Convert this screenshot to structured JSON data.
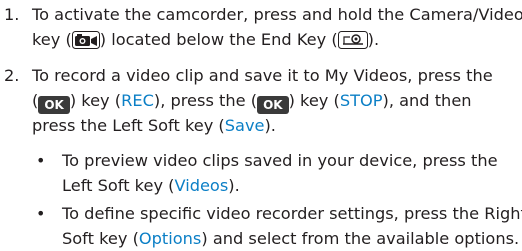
{
  "steps": [
    {
      "number": "1.",
      "line1": {
        "before": "To activate the camcorder, press and hold the Camera/Video"
      },
      "line2": {
        "before": "key (",
        "middle": ") located below the End Key (",
        "after": ")."
      },
      "icons": [
        "camera-video-key-icon",
        "end-key-icon"
      ]
    },
    {
      "number": "2.",
      "line1": {
        "before": "To record a video clip and save it to My Videos, press the"
      },
      "line2": {
        "open": "(",
        "key1": "OK",
        "mid1": ") key (",
        "rec": "REC",
        "mid2": "), press the (",
        "key2": "OK",
        "mid3": ") key (",
        "stop": "STOP",
        "after": "), and then"
      },
      "line3": {
        "before": "press the Left Soft key (",
        "save": "Save",
        "after": ")."
      }
    }
  ],
  "bullets": [
    {
      "line1": "To preview video clips saved in your device, press the",
      "line2_before": "Left Soft key (",
      "line2_hl": "Videos",
      "line2_after": ")."
    },
    {
      "line1": "To define specific video recorder settings, press the Right",
      "line2_before": "Soft key (",
      "line2_hl": "Options",
      "line2_after": ") and select from the available options."
    }
  ],
  "colors": {
    "text": "#231f20",
    "highlight": "#0b7fc6",
    "key_background": "#3a3a3a"
  }
}
